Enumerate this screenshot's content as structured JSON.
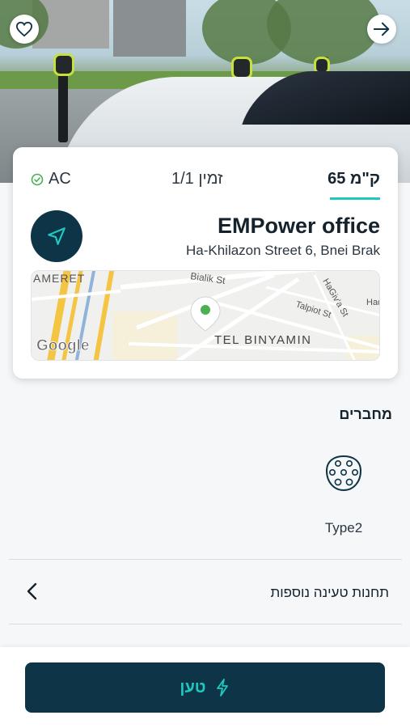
{
  "colors": {
    "navy": "#0e3447",
    "accent": "#1ec9c0",
    "available": "#4caf50"
  },
  "header": {
    "favorite_icon": "heart-icon",
    "share_icon": "arrow-right-icon"
  },
  "station": {
    "power": "65 ק\"מ",
    "availability": "1/1 זמין",
    "current_type": "AC",
    "name": "EMPower office",
    "address": "Ha-Khilazon Street 6, Bnei Brak",
    "navigate_icon": "navigation-arrow-icon"
  },
  "map": {
    "labels": {
      "area_left": "AMERET",
      "street_1": "Bialik St",
      "street_2": "HaGiv'a St",
      "street_3": "Talpiot St",
      "street_4": "Had",
      "district": "TEL BINYAMIN",
      "logo": "Google"
    }
  },
  "connectors": {
    "title": "מחברים",
    "items": [
      {
        "label": "Type2",
        "icon": "type2-plug-icon"
      }
    ]
  },
  "more_stations": {
    "label": "תחנות טעינה נוספות",
    "icon": "chevron-left-icon"
  },
  "charge_button": {
    "label": "טען",
    "icon": "lightning-bolt-icon"
  }
}
